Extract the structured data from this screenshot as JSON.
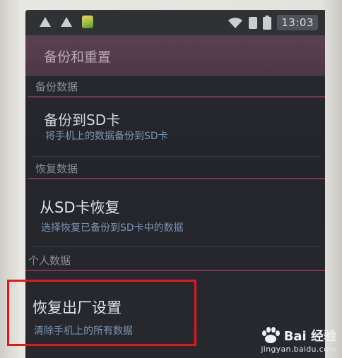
{
  "status_bar": {
    "time": "13:03",
    "icons": [
      "warning-icon",
      "warning-icon",
      "app-notification-icon",
      "wifi-icon",
      "sim-icon",
      "battery-icon"
    ]
  },
  "title_bar": {
    "title": "备份和重置"
  },
  "sections": [
    {
      "header": "备份数据",
      "items": [
        {
          "title": "备份到SD卡",
          "subtitle": "将手机上的数据备份到SD卡"
        }
      ]
    },
    {
      "header": "恢复数据",
      "items": [
        {
          "title": "从SD卡恢复",
          "subtitle": "选择恢复已备份到SD卡中的数据"
        }
      ]
    },
    {
      "header": "个人数据",
      "items": [
        {
          "title": "恢复出厂设置",
          "subtitle": "清除手机上的所有数据"
        }
      ]
    }
  ],
  "watermark": {
    "brand": "Bai 经验",
    "url": "jingyan.baidu.com"
  },
  "colors": {
    "title_bar": "#4b3442",
    "section_rule": "#6a3d4d",
    "subtitle": "#7c93b0",
    "highlight": "#e41818"
  }
}
